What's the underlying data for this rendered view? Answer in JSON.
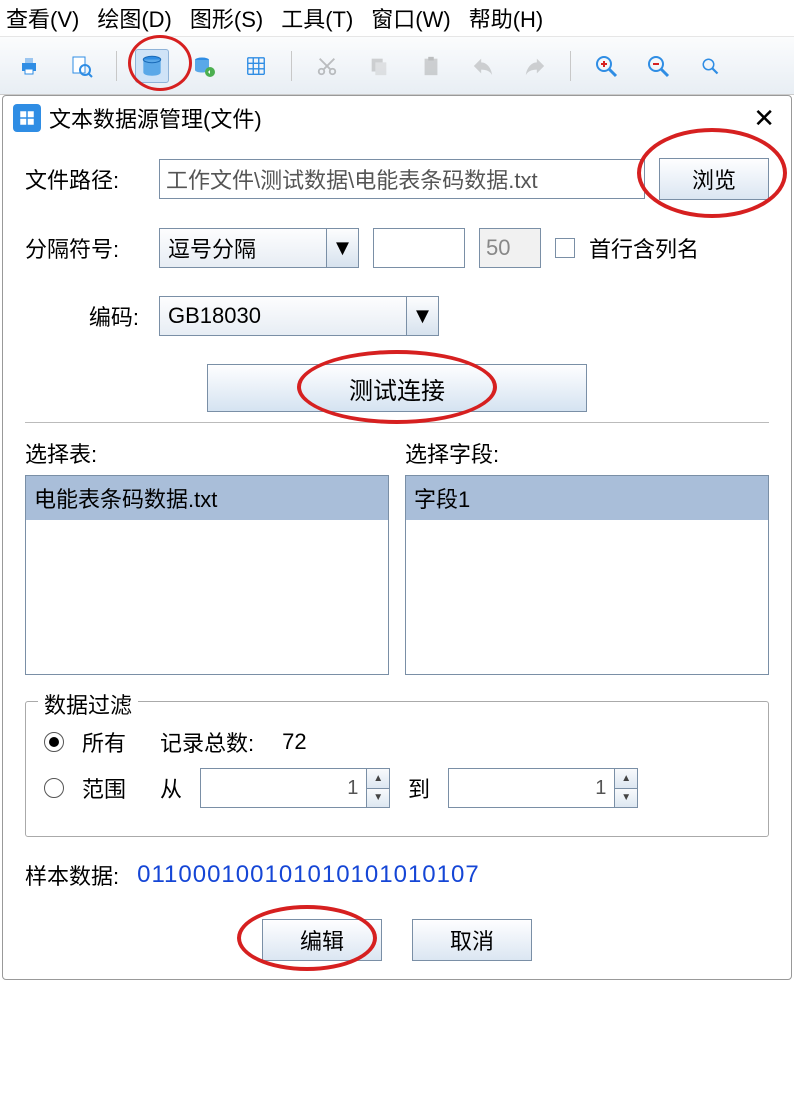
{
  "menubar": {
    "view": "查看(V)",
    "draw": "绘图(D)",
    "shape": "图形(S)",
    "tool": "工具(T)",
    "window": "窗口(W)",
    "help": "帮助(H)"
  },
  "dialog": {
    "title": "文本数据源管理(文件)",
    "close": "✕"
  },
  "filepath": {
    "label": "文件路径:",
    "value": "工作文件\\测试数据\\电能表条码数据.txt",
    "browse": "浏览"
  },
  "delimiter": {
    "label": "分隔符号:",
    "selected": "逗号分隔",
    "extra_value": "",
    "extra_disabled": "50",
    "header_checkbox_label": "首行含列名"
  },
  "encoding": {
    "label": "编码:",
    "selected": "GB18030"
  },
  "test_button": "测试连接",
  "select_table_label": "选择表:",
  "select_field_label": "选择字段:",
  "table_item": "电能表条码数据.txt",
  "field_item": "字段1",
  "filter": {
    "legend": "数据过滤",
    "all_label": "所有",
    "count_label": "记录总数:",
    "count_value": "72",
    "range_label": "范围",
    "from_label": "从",
    "from_value": "1",
    "to_label": "到",
    "to_value": "1"
  },
  "sample": {
    "label": "样本数据:",
    "value": "011000100101010101010107"
  },
  "buttons": {
    "edit": "编辑",
    "cancel": "取消"
  }
}
